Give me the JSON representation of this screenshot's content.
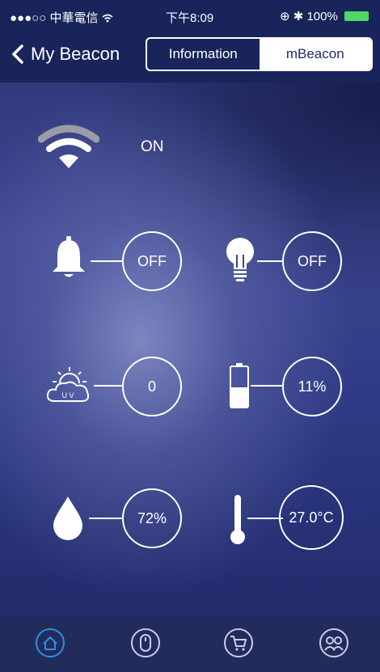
{
  "status_bar": {
    "carrier": "●●●○○ 中華電信 ",
    "time": "下午8:09",
    "battery": "100%"
  },
  "nav": {
    "back_label": "My Beacon",
    "segments": [
      "Information",
      "mBeacon"
    ],
    "selected": "mBeacon"
  },
  "beacon": {
    "wifi_status": "ON",
    "bell": "OFF",
    "light": "OFF",
    "uv": "0",
    "battery_level": "11%",
    "humidity": "72%",
    "temperature": "27.0°C"
  },
  "icons": {
    "uv_icon_text": "U V"
  },
  "tabs": [
    "home-icon",
    "mouse-icon",
    "cart-icon",
    "friends-icon"
  ],
  "colors": {
    "active_tab": "#2f8ee8",
    "inactive_tab": "#c9cde6",
    "navbar": "#18245a"
  }
}
